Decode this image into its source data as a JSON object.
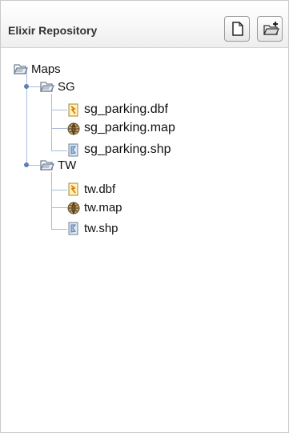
{
  "panel": {
    "title": "Elixir Repository",
    "toolbar": {
      "new_icon": "new-document-icon",
      "add_icon": "add-folder-icon"
    }
  },
  "tree": {
    "root": {
      "label": "Maps",
      "icon": "folder-open-icon"
    },
    "groups": [
      {
        "label": "SG",
        "icon": "folder-open-icon",
        "files": [
          {
            "label": "sg_parking.dbf",
            "icon": "dbf-file-icon"
          },
          {
            "label": "sg_parking.map",
            "icon": "globe-map-icon"
          },
          {
            "label": "sg_parking.shp",
            "icon": "shp-file-icon"
          }
        ]
      },
      {
        "label": "TW",
        "icon": "folder-open-icon",
        "files": [
          {
            "label": "tw.dbf",
            "icon": "dbf-file-icon"
          },
          {
            "label": "tw.map",
            "icon": "globe-map-icon"
          },
          {
            "label": "tw.shp",
            "icon": "shp-file-icon"
          }
        ]
      }
    ]
  },
  "colors": {
    "connector": "#a9bbd8",
    "handle": "#5e7fb5",
    "folder": "#6f7f94"
  }
}
